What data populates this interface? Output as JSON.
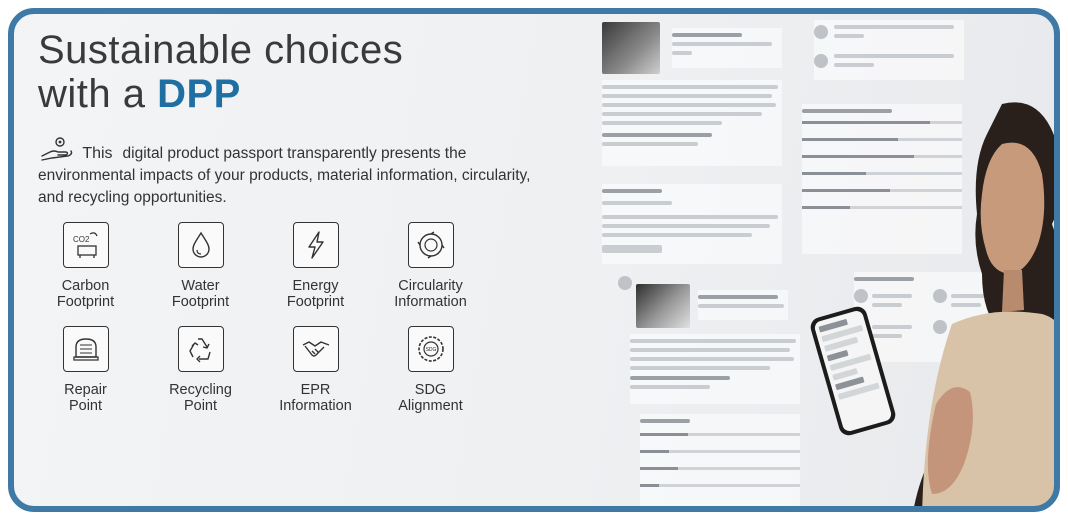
{
  "header": {
    "title_line1": "Sustainable choices",
    "title_line2_prefix": "with a ",
    "title_line2_accent": "DPP"
  },
  "intro": {
    "lead": "This",
    "text": "digital product passport transparently presents the environmental impacts of your products, material information, circularity, and recycling opportunities."
  },
  "features": [
    {
      "label": "Carbon\nFootprint",
      "icon": "carbon-icon"
    },
    {
      "label": "Water\nFootprint",
      "icon": "water-drop-icon"
    },
    {
      "label": "Energy\nFootprint",
      "icon": "lightning-icon"
    },
    {
      "label": "Circularity\nInformation",
      "icon": "circular-arrows-icon"
    },
    {
      "label": "Repair\nPoint",
      "icon": "sewing-icon"
    },
    {
      "label": "Recycling\nPoint",
      "icon": "recycle-icon"
    },
    {
      "label": "EPR\nInformation",
      "icon": "handshake-icon"
    },
    {
      "label": "SDG\nAlignment",
      "icon": "sdg-icon"
    }
  ],
  "colors": {
    "frame": "#3f79a6",
    "accent": "#1f6fa3",
    "text": "#333333"
  }
}
